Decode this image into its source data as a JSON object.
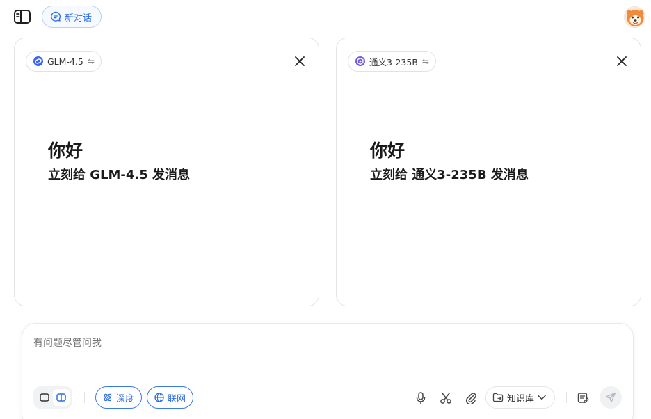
{
  "header": {
    "new_chat_label": "新对话"
  },
  "panels": [
    {
      "model_name": "GLM-4.5",
      "swap_glyph": "⇋",
      "model_icon": "glm-logo-icon",
      "greeting": "你好",
      "subtitle": "立刻给 GLM-4.5 发消息"
    },
    {
      "model_name": "通义3-235B",
      "swap_glyph": "⇋",
      "model_icon": "qwen-logo-icon",
      "greeting": "你好",
      "subtitle": "立刻给 通义3-235B 发消息"
    }
  ],
  "composer": {
    "placeholder": "有问题尽管问我",
    "deep_label": "深度",
    "web_label": "联网",
    "knowledge_label": "知识库"
  },
  "colors": {
    "accent": "#2f6fe4",
    "glm_brand": "#3a66f0",
    "qwen_brand": "#6e5ae0"
  }
}
